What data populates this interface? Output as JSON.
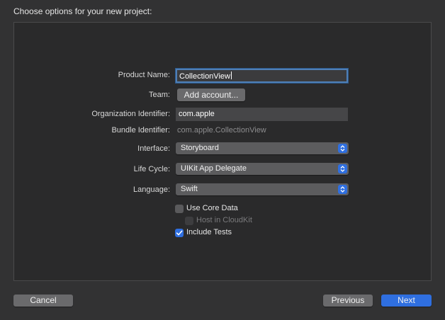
{
  "dialog": {
    "title": "Choose options for your new project:"
  },
  "form": {
    "product_name": {
      "label": "Product Name:",
      "value": "CollectionView"
    },
    "team": {
      "label": "Team:",
      "button_label": "Add account..."
    },
    "organization_identifier": {
      "label": "Organization Identifier:",
      "value": "com.apple"
    },
    "bundle_identifier": {
      "label": "Bundle Identifier:",
      "value": "com.apple.CollectionView"
    },
    "interface": {
      "label": "Interface:",
      "selected": "Storyboard"
    },
    "life_cycle": {
      "label": "Life Cycle:",
      "selected": "UIKit App Delegate"
    },
    "language": {
      "label": "Language:",
      "selected": "Swift"
    },
    "checkboxes": {
      "use_core_data": {
        "label": "Use Core Data",
        "checked": false,
        "enabled": true
      },
      "host_in_cloudkit": {
        "label": "Host in CloudKit",
        "checked": false,
        "enabled": false
      },
      "include_tests": {
        "label": "Include Tests",
        "checked": true,
        "enabled": true
      }
    }
  },
  "footer": {
    "cancel_label": "Cancel",
    "previous_label": "Previous",
    "next_label": "Next"
  },
  "colors": {
    "window_bg": "#323233",
    "panel_bg": "#2a2a2b",
    "accent": "#2f6fe0",
    "focus_ring": "#4f7fb6"
  },
  "icons": {
    "popup_arrows": "chevron-up-down-icon",
    "checkmark": "checkmark-icon"
  }
}
